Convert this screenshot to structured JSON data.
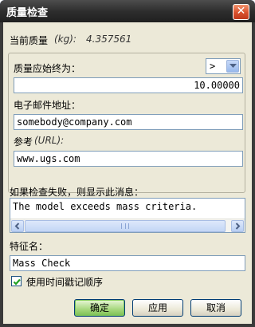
{
  "window": {
    "title": "质量检查",
    "close_glyph": "✕"
  },
  "current_mass": {
    "label": "当前质量",
    "unit": "(kg):",
    "value": "4.357561"
  },
  "mass_condition": {
    "label": "质量应始终为：",
    "operator": ">",
    "value": "10.00000"
  },
  "email": {
    "label": "电子邮件地址：",
    "value": "somebody@company.com"
  },
  "reference": {
    "label": "参考",
    "unit": "(URL):",
    "value": "www.ugs.com"
  },
  "failure_message": {
    "label": "如果检查失败，则显示此消息：",
    "value": "The model exceeds mass criteria."
  },
  "feature_name": {
    "label": "特征名：",
    "value": "Mass Check"
  },
  "timestamp_order": {
    "label": "使用时间戳记顺序",
    "checked": true
  },
  "buttons": {
    "ok": "确定",
    "apply": "应用",
    "cancel": "取消"
  }
}
